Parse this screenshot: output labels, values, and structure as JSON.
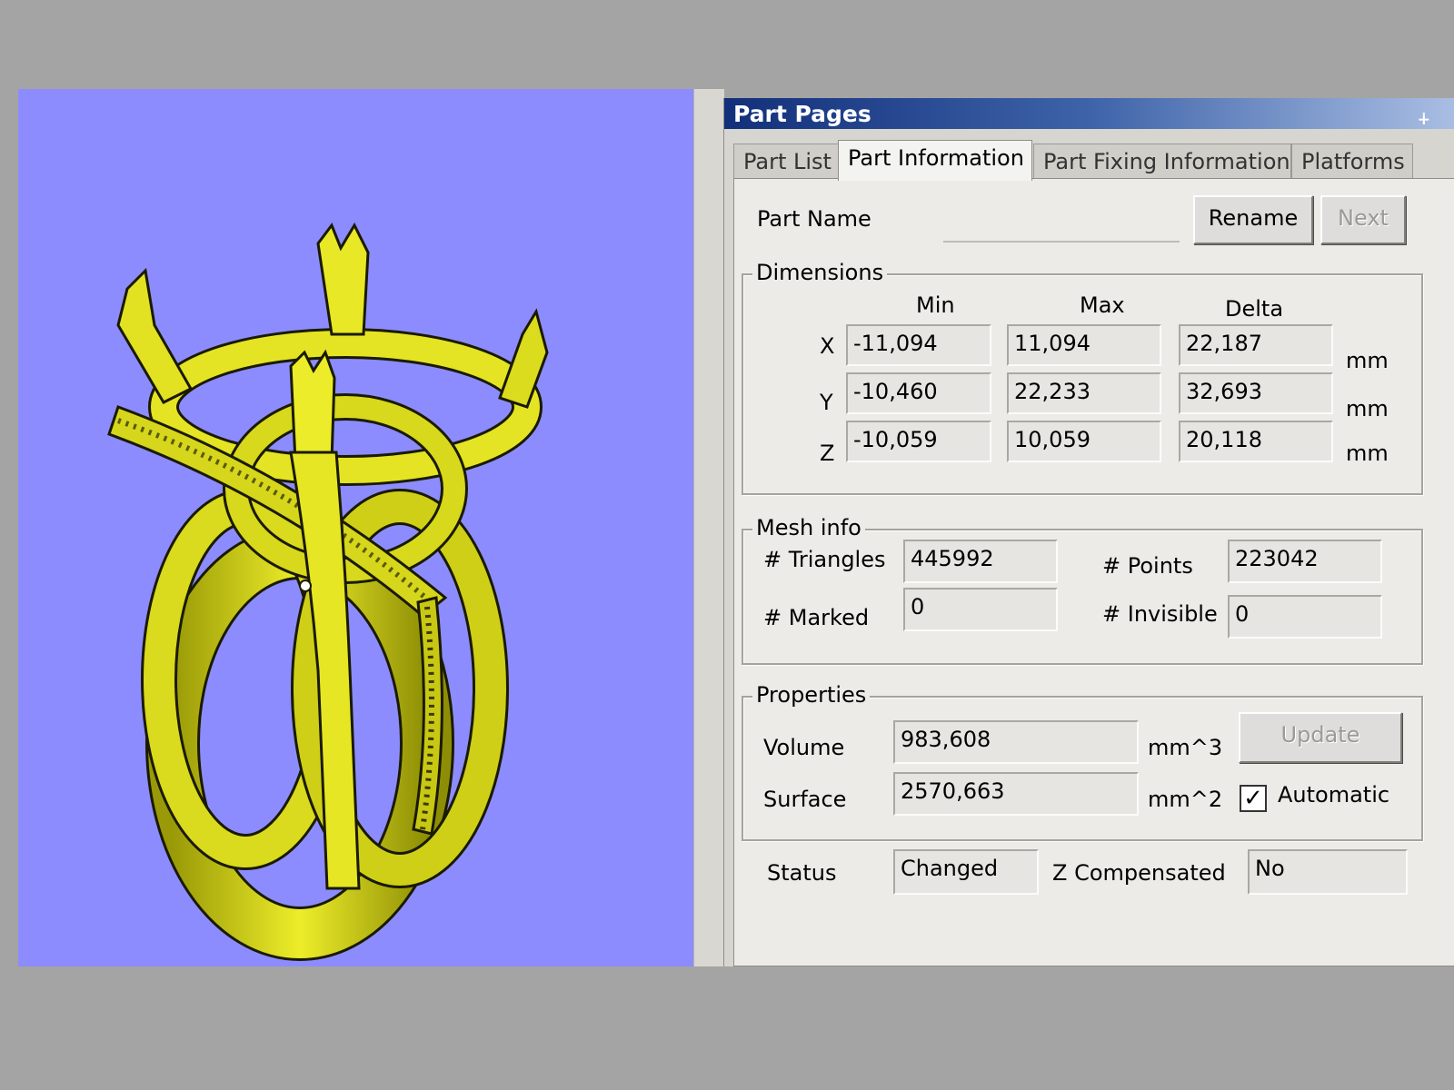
{
  "panel": {
    "title": "Part Pages",
    "tabs": [
      {
        "label": "Part List",
        "active": false
      },
      {
        "label": "Part Information",
        "active": true
      },
      {
        "label": "Part Fixing Information",
        "active": false
      },
      {
        "label": "Platforms",
        "active": false
      }
    ]
  },
  "part_name": {
    "label": "Part Name",
    "value": "",
    "rename_label": "Rename",
    "next_label": "Next"
  },
  "dimensions": {
    "title": "Dimensions",
    "headers": {
      "min": "Min",
      "max": "Max",
      "delta": "Delta"
    },
    "rows": [
      {
        "axis": "X",
        "min": "-11,094",
        "max": "11,094",
        "delta": "22,187",
        "unit": "mm"
      },
      {
        "axis": "Y",
        "min": "-10,460",
        "max": "22,233",
        "delta": "32,693",
        "unit": "mm"
      },
      {
        "axis": "Z",
        "min": "-10,059",
        "max": "10,059",
        "delta": "20,118",
        "unit": "mm"
      }
    ]
  },
  "mesh": {
    "title": "Mesh info",
    "triangles_label": "# Triangles",
    "triangles": "445992",
    "points_label": "# Points",
    "points": "223042",
    "marked_label": "# Marked",
    "marked": "0",
    "invisible_label": "# Invisible",
    "invisible": "0"
  },
  "properties": {
    "title": "Properties",
    "volume_label": "Volume",
    "volume": "983,608",
    "volume_unit": "mm^3",
    "surface_label": "Surface",
    "surface": "2570,663",
    "surface_unit": "mm^2",
    "update_label": "Update",
    "automatic_label": "Automatic",
    "automatic_checked": true
  },
  "status": {
    "status_label": "Status",
    "status_value": "Changed",
    "zcomp_label": "Z Compensated",
    "zcomp_value": "No"
  },
  "colors": {
    "viewport_bg": "#8c8cff",
    "model": "#e8e820",
    "title_bar": "#12307a"
  },
  "icons": [
    "pin-icon",
    "check-icon",
    "ring-model"
  ]
}
